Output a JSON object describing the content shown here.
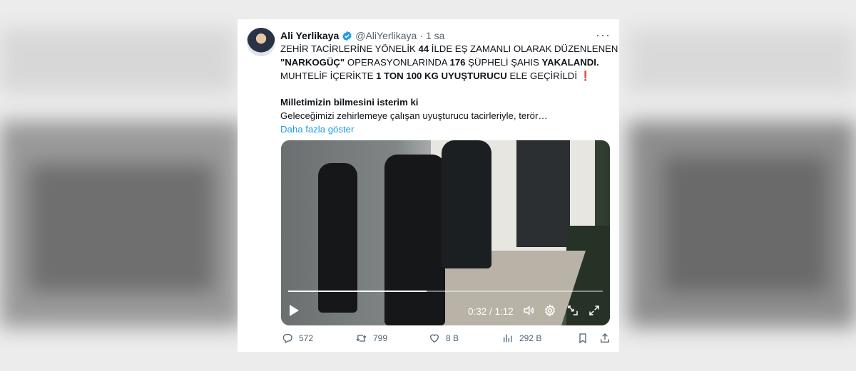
{
  "tweet": {
    "author_name": "Ali Yerlikaya",
    "handle": "@AliYerlikaya",
    "separator": "·",
    "time": "1 sa",
    "more_icon": "···",
    "lines": {
      "l1_a": "ZEHİR TACİRLERİNE YÖNELİK ",
      "l1_b": "44",
      "l1_c": " İLDE EŞ ZAMANLI OLARAK DÜZENLENEN",
      "l2_a": "\"NARKOGÜÇ\"",
      "l2_b": " OPERASYONLARINDA ",
      "l2_c": "176",
      "l2_d": " ŞÜPHELİ ŞAHIS ",
      "l2_e": "YAKALANDI.",
      "l3_a": "MUHTELİF İÇERİKTE ",
      "l3_b": "1 TON 100 KG UYUŞTURUCU",
      "l3_c": " ELE GEÇİRİLDİ",
      "l3_d": "❗"
    },
    "subheading": "Milletimizin bilmesini isterim ki",
    "truncated_text": "Geleceğimizi zehirlemeye çalışan uyuşturucu tacirleriyle, terör…",
    "show_more": "Daha fazla göster"
  },
  "video": {
    "current_time": "0:32",
    "duration": "1:12",
    "time_display": "0:32 / 1:12",
    "progress_fraction": 0.44
  },
  "actions": {
    "replies": "572",
    "retweets": "799",
    "likes": "8 B",
    "views": "292 B"
  },
  "colors": {
    "accent": "#1d9bf0",
    "text": "#0f1419",
    "muted": "#536471"
  }
}
